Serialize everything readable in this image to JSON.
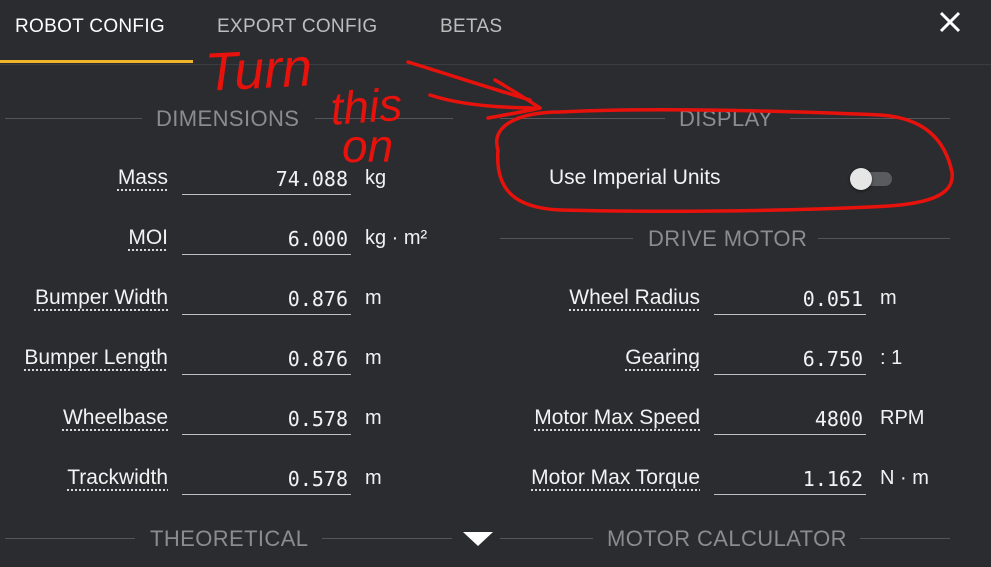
{
  "tabs": [
    {
      "label": "ROBOT CONFIG",
      "active": true
    },
    {
      "label": "EXPORT CONFIG",
      "active": false
    },
    {
      "label": "BETAS",
      "active": false
    }
  ],
  "sections": {
    "dimensions": "DIMENSIONS",
    "display": "DISPLAY",
    "drive_motor": "DRIVE MOTOR",
    "theoretical": "THEORETICAL",
    "motor_calculator": "MOTOR CALCULATOR"
  },
  "dimensions": [
    {
      "label": "Mass",
      "value": "74.088",
      "unit": "kg"
    },
    {
      "label": "MOI",
      "value": "6.000",
      "unit": "kg · m²"
    },
    {
      "label": "Bumper Width",
      "value": "0.876",
      "unit": "m"
    },
    {
      "label": "Bumper Length",
      "value": "0.876",
      "unit": "m"
    },
    {
      "label": "Wheelbase",
      "value": "0.578",
      "unit": "m"
    },
    {
      "label": "Trackwidth",
      "value": "0.578",
      "unit": "m"
    }
  ],
  "display": {
    "imperial_label": "Use Imperial Units",
    "imperial_enabled": false
  },
  "drive_motor": [
    {
      "label": "Wheel Radius",
      "value": "0.051",
      "unit": "m"
    },
    {
      "label": "Gearing",
      "value": "6.750",
      "unit": ": 1"
    },
    {
      "label": "Motor Max Speed",
      "value": "4800",
      "unit": "RPM"
    },
    {
      "label": "Motor Max Torque",
      "value": "1.162",
      "unit": "N · m"
    }
  ],
  "annotation": {
    "line1": "Turn",
    "line2": "this",
    "line3": "on",
    "color": "#e8120c"
  },
  "colors": {
    "background": "#2a2c30",
    "tab_accent": "#f0b429"
  }
}
